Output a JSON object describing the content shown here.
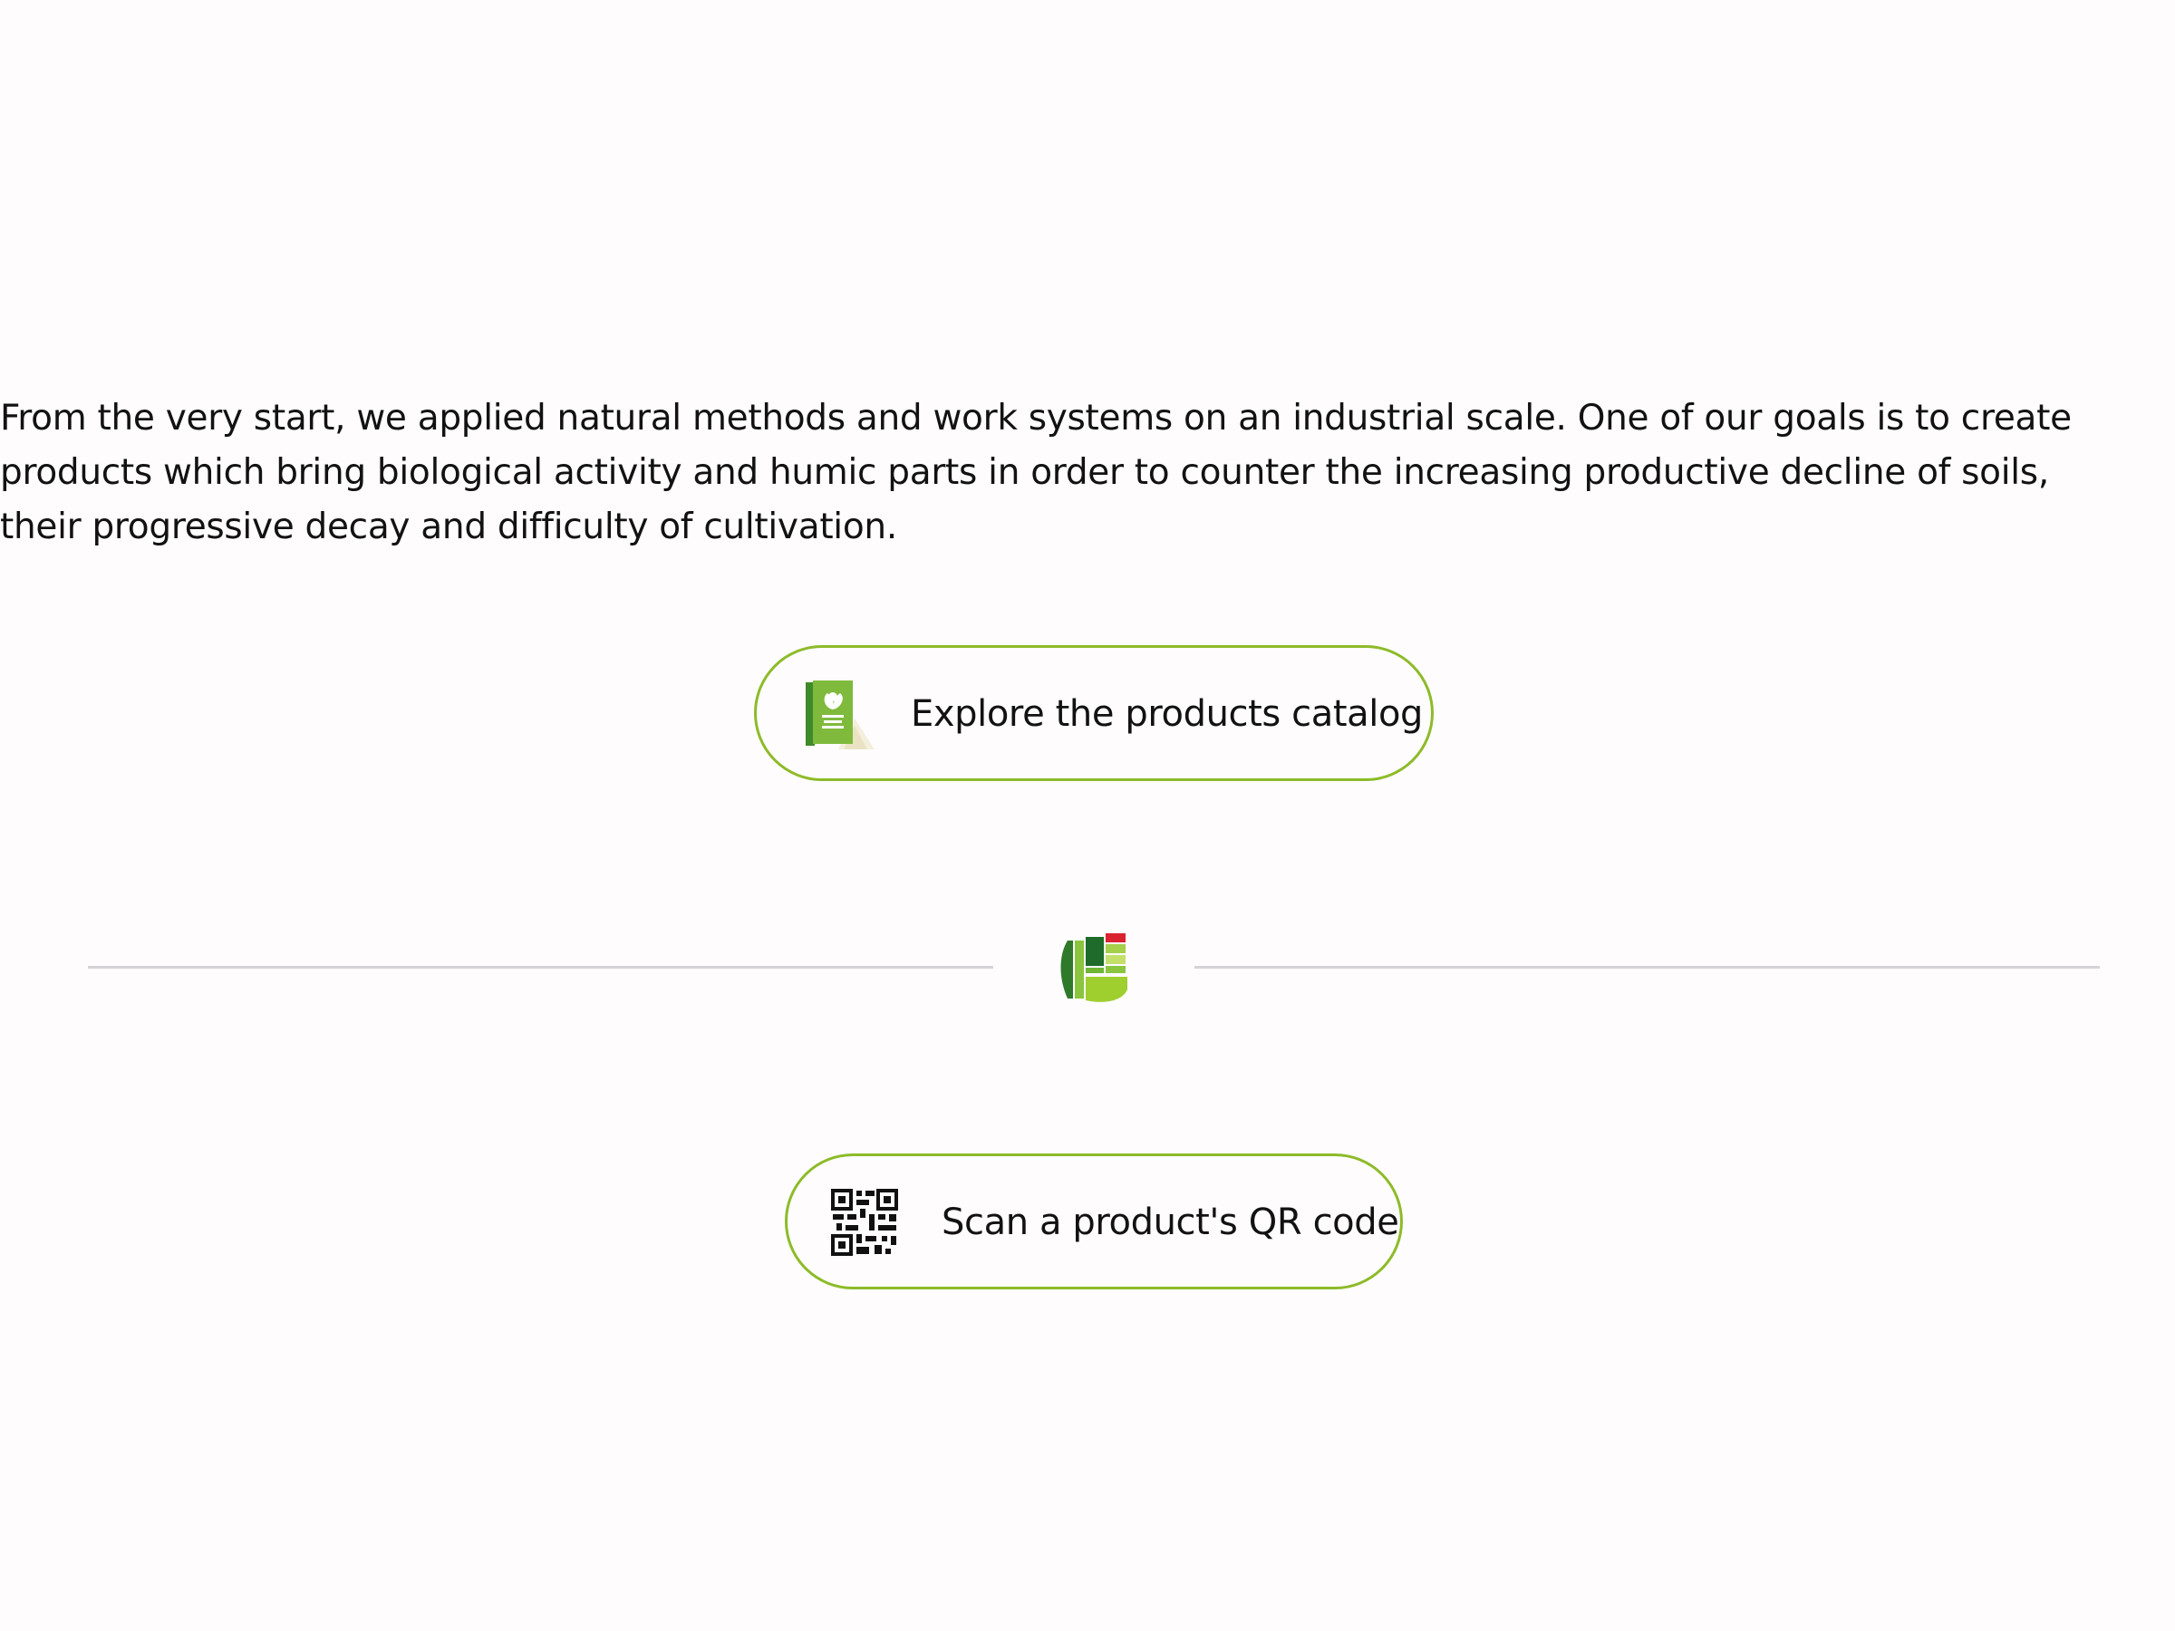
{
  "intro": {
    "text": "From the very start, we applied natural methods and work systems on an industrial scale. One of our goals is to create products which bring biological activity and humic parts in order to counter the increasing productive decline of soils, their progressive decay and difficulty of cultivation."
  },
  "catalog_button": {
    "label": "Explore the products catalog",
    "icon": "product-catalog-icon"
  },
  "divider": {
    "icon": "brand-logo-icon"
  },
  "qr_button": {
    "label": "Scan a product's QR code",
    "icon": "qr-code-icon"
  },
  "colors": {
    "accent": "#8dbb29",
    "text": "#121212",
    "divider": "#d5d3d6",
    "background": "#fefcfd"
  }
}
